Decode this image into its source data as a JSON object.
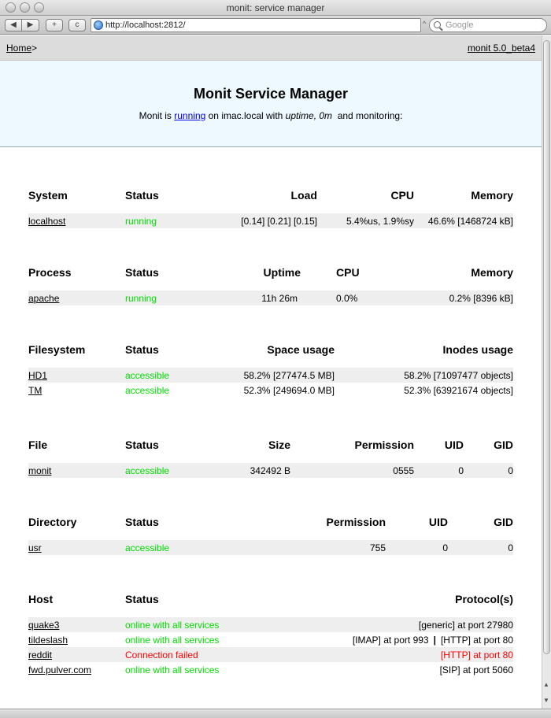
{
  "window": {
    "title": "monit: service manager"
  },
  "toolbar": {
    "back_label": "◀",
    "forward_label": "▶",
    "add_label": "+",
    "reload_label": "c",
    "url": "http://localhost:2812/",
    "search_placeholder": "Google"
  },
  "header": {
    "home_label": "Home",
    "home_suffix": ">",
    "version_link": "monit 5.0_beta4"
  },
  "banner": {
    "title": "Monit Service Manager",
    "prefix": "Monit is ",
    "state": "running",
    "middle": " on imac.local with ",
    "uptime": "uptime, 0m",
    "suffix": "  and monitoring:"
  },
  "system": {
    "headers": [
      "System",
      "Status",
      "Load",
      "CPU",
      "Memory"
    ],
    "rows": [
      {
        "name": "localhost",
        "status": "running",
        "load": "[0.14] [0.21] [0.15]",
        "cpu": "5.4%us, 1.9%sy",
        "memory": "46.6% [1468724 kB]"
      }
    ]
  },
  "process": {
    "headers": [
      "Process",
      "Status",
      "Uptime",
      "CPU",
      "Memory"
    ],
    "rows": [
      {
        "name": "apache",
        "status": "running",
        "uptime": "11h 26m",
        "cpu": "0.0%",
        "memory": "0.2% [8396 kB]"
      }
    ]
  },
  "filesystem": {
    "headers": [
      "Filesystem",
      "Status",
      "Space usage",
      "Inodes usage"
    ],
    "rows": [
      {
        "name": "HD1",
        "status": "accessible",
        "space": "58.2% [277474.5 MB]",
        "inodes": "58.2% [71097477 objects]"
      },
      {
        "name": "TM",
        "status": "accessible",
        "space": "52.3% [249694.0 MB]",
        "inodes": "52.3% [63921674 objects]"
      }
    ]
  },
  "file": {
    "headers": [
      "File",
      "Status",
      "Size",
      "Permission",
      "UID",
      "GID"
    ],
    "rows": [
      {
        "name": "monit",
        "status": "accessible",
        "size": "342492 B",
        "permission": "0555",
        "uid": "0",
        "gid": "0"
      }
    ]
  },
  "directory": {
    "headers": [
      "Directory",
      "Status",
      "Permission",
      "UID",
      "GID"
    ],
    "rows": [
      {
        "name": "usr",
        "status": "accessible",
        "permission": "755",
        "uid": "0",
        "gid": "0"
      }
    ]
  },
  "host": {
    "headers": [
      "Host",
      "Status",
      "Protocol(s)"
    ],
    "separator": "|",
    "rows": [
      {
        "name": "quake3",
        "status": "online with all services",
        "protocol": "[generic] at port 27980"
      },
      {
        "name": "tildeslash",
        "status": "online with all services",
        "protocol": "[IMAP] at port 993",
        "protocol2": "[HTTP] at port 80"
      },
      {
        "name": "reddit",
        "status": "Connection failed",
        "protocol": "[HTTP] at port 80"
      },
      {
        "name": "fwd.pulver.com",
        "status": "online with all services",
        "protocol": "[SIP] at port 5060"
      }
    ]
  },
  "colors": {
    "ok": "#00dd00",
    "fail": "#ff0000",
    "banner_bg": "#eef8ff",
    "row_shade": "#eeeeee"
  }
}
